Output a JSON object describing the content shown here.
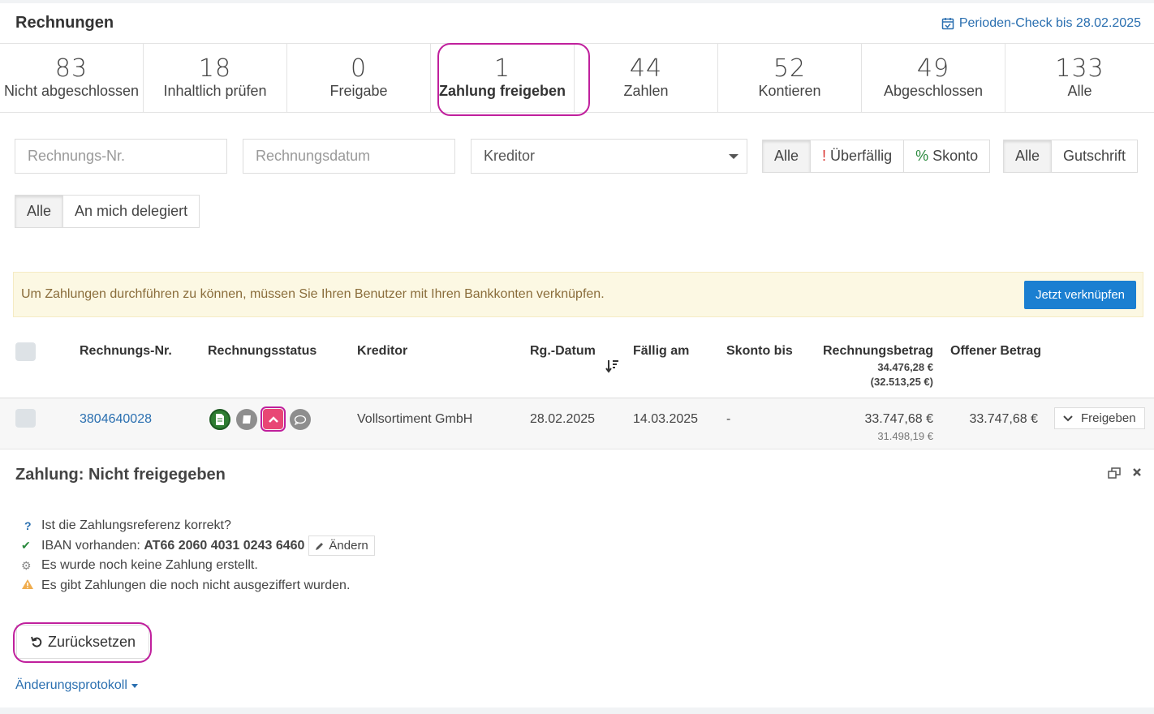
{
  "header": {
    "title": "Rechnungen",
    "period_check": "Perioden-Check bis 28.02.2025"
  },
  "tabs": [
    {
      "count": "83",
      "label": "Nicht abgeschlossen"
    },
    {
      "count": "18",
      "label": "Inhaltlich prüfen"
    },
    {
      "count": "0",
      "label": "Freigabe"
    },
    {
      "count": "1",
      "label": "Zahlung freigeben"
    },
    {
      "count": "44",
      "label": "Zahlen"
    },
    {
      "count": "52",
      "label": "Kontieren"
    },
    {
      "count": "49",
      "label": "Abgeschlossen"
    },
    {
      "count": "133",
      "label": "Alle"
    }
  ],
  "active_tab": "Zahlung freigeben",
  "filters": {
    "invoice_no_placeholder": "Rechnungs-Nr.",
    "invoice_date_placeholder": "Rechnungsdatum",
    "creditor_select": "Kreditor",
    "status_group": {
      "all": "Alle",
      "overdue_mark": "!",
      "overdue": "Überfällig",
      "skonto_mark": "%",
      "skonto": "Skonto"
    },
    "type_group": {
      "all": "Alle",
      "credit": "Gutschrift"
    },
    "delegation_group": {
      "all": "Alle",
      "delegated": "An mich delegiert"
    }
  },
  "alert": {
    "text": "Um Zahlungen durchführen zu können, müssen Sie Ihren Benutzer mit Ihren Bankkonten verknüpfen.",
    "button": "Jetzt verknüpfen"
  },
  "table": {
    "headers": {
      "invoice_no": "Rechnungs-Nr.",
      "status": "Rechnungsstatus",
      "creditor": "Kreditor",
      "invoice_date": "Rg.-Datum",
      "due": "Fällig am",
      "skonto_until": "Skonto bis",
      "amount": "Rechnungsbetrag",
      "amount_total": "34.476,28 €",
      "amount_total_sub": "(32.513,25 €)",
      "open": "Offener Betrag"
    },
    "rows": [
      {
        "invoice_no": "3804640028",
        "creditor": "Vollsortiment GmbH",
        "invoice_date": "28.02.2025",
        "due": "14.03.2025",
        "skonto_until": "-",
        "amount": "33.747,68 €",
        "amount_sub": "31.498,19 €",
        "open": "33.747,68 €",
        "action": "Freigeben"
      }
    ]
  },
  "detail": {
    "title": "Zahlung: Nicht freigegeben",
    "checks": {
      "reference": "Ist die Zahlungsreferenz korrekt?",
      "iban_label": "IBAN vorhanden:",
      "iban_value": "AT66 2060 4031 0243 6460",
      "iban_change": "Ändern",
      "no_payment": "Es wurde noch keine Zahlung erstellt.",
      "not_settled": "Es gibt Zahlungen die noch nicht ausgeziffert wurden."
    },
    "reset_button": "Zurücksetzen",
    "change_log": "Änderungsprotokoll"
  },
  "colors": {
    "accent": "#2a6fb0",
    "highlight": "#c0209d",
    "primary_button": "#1b7fd1",
    "alert_bg": "#fcf8e3"
  }
}
